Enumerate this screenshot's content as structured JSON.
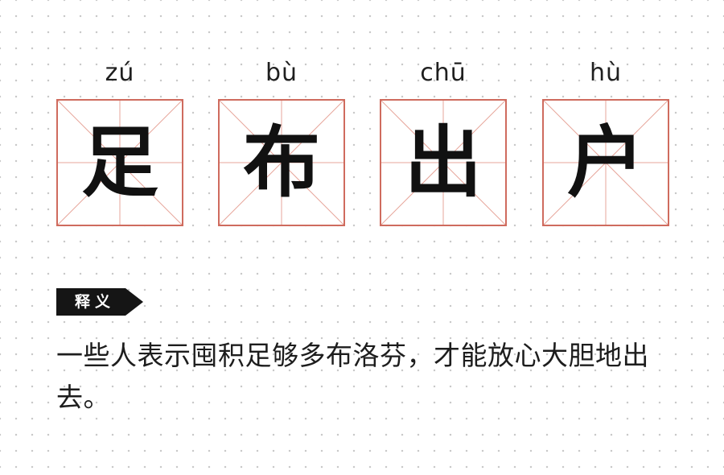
{
  "characters": [
    {
      "pinyin": "zú",
      "hanzi": "足"
    },
    {
      "pinyin": "bù",
      "hanzi": "布"
    },
    {
      "pinyin": "chū",
      "hanzi": "出"
    },
    {
      "pinyin": "hù",
      "hanzi": "户"
    }
  ],
  "tag": {
    "label": "释义"
  },
  "definition": {
    "text": "一些人表示囤积足够多布洛芬，才能放心大胆地出去。"
  },
  "colors": {
    "grid_border": "#cf6b5e",
    "grid_guides": "#e7a59b",
    "text": "#111111",
    "tag_background": "#151515",
    "dot": "#c9c9c9"
  }
}
